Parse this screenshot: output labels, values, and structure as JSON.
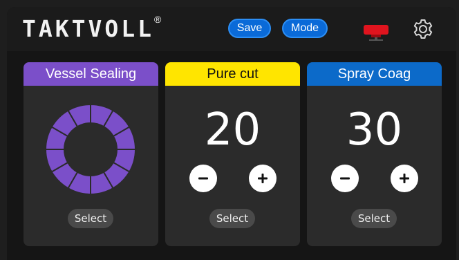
{
  "header": {
    "brand": "TAKTVOLL",
    "brand_mark": "®",
    "save_label": "Save",
    "mode_label": "Mode"
  },
  "panels": [
    {
      "title": "Vessel Sealing",
      "select_label": "Select",
      "color": "#7b4fc9"
    },
    {
      "title": "Pure cut",
      "value": "20",
      "select_label": "Select",
      "color": "#ffe500"
    },
    {
      "title": "Spray Coag",
      "value": "30",
      "select_label": "Select",
      "color": "#0c6ac9"
    }
  ],
  "icons": {
    "connector": "plug-connector-icon",
    "settings": "gear-icon",
    "minus": "minus-icon",
    "plus": "plus-icon",
    "ring": "segmented-ring-indicator"
  },
  "colors": {
    "accent_blue": "#0a6ad8",
    "connector_red": "#e0141e",
    "ring_purple": "#7b4fc9"
  }
}
